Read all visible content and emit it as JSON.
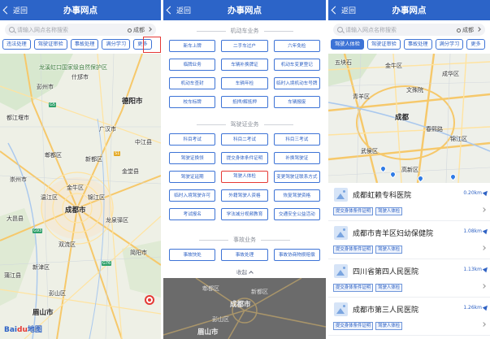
{
  "common": {
    "back_label": "返回",
    "title": "办事网点",
    "search_placeholder": "请输入网点名称搜索",
    "city": "成都",
    "logo_bai": "Bai",
    "logo_du": "du",
    "logo_cn": "地图"
  },
  "screen1": {
    "chips": [
      "违法处理",
      "驾驶证审验",
      "事故处理",
      "满分学习",
      "更多"
    ],
    "map_labels": {
      "city_main": "成都市",
      "city_deyang": "德阳市",
      "city_meishan": "眉山市",
      "area_1": "龙溪虹口国家级自然保护区",
      "area_2": "彭州市",
      "area_3": "什邡市",
      "area_4": "广汉市",
      "area_5": "中江县",
      "area_6": "都江堰市",
      "area_7": "郫都区",
      "area_8": "新都区",
      "area_9": "金堂县",
      "area_10": "崇州市",
      "area_11": "温江区",
      "area_12": "金牛区",
      "area_13": "锦江区",
      "area_14": "龙泉驿区",
      "area_15": "大邑县",
      "area_16": "双流区",
      "area_17": "简阳市",
      "area_18": "新津区",
      "area_19": "蒲江县",
      "area_20": "彭山区"
    }
  },
  "screen2": {
    "section_vehicle": "机动车业务",
    "vehicle_items": [
      "新车上牌",
      "二手车过户",
      "六年免检",
      "临牌业务",
      "车辆补换牌证",
      "机动车变更登记",
      "机动车查封",
      "车辆年检",
      "临时入境机动车号牌",
      "校车标牌",
      "抵押/解抵押",
      "车辆报废"
    ],
    "section_license": "驾驶证业务",
    "license_items": [
      "科目考试",
      "科目二考试",
      "科目三考试",
      "驾驶证换领",
      "提交身体条件证明",
      "补换驾驶证",
      "驾驶证延期",
      "驾驶人体检",
      "变更驾驶证联系方式",
      "临时入境驾驶许可",
      "外籍驾驶人资格",
      "恢复驾驶资格",
      "考试报名",
      "学法减分视频教育",
      "交通安全公益活动"
    ],
    "highlighted_item": "驾驶人体检",
    "section_accident": "事故业务",
    "accident_items": [
      "事故快处",
      "事故处理",
      "事故协商物损赔偿"
    ],
    "collapse_label": "收起",
    "dim_labels": {
      "city_main": "成都市",
      "city_meishan": "眉山市",
      "area_1": "郫都区",
      "area_2": "新都区",
      "area_3": "彭山区"
    }
  },
  "screen3": {
    "chips": [
      "驾驶人体检",
      "驾驶证审验",
      "事故处理",
      "满分学习",
      "更多"
    ],
    "selected_chip": "驾驶人体检",
    "map_labels": {
      "area_1": "成都",
      "area_2": "金牛区",
      "area_3": "成华区",
      "area_4": "青羊区",
      "area_5": "锦江区",
      "area_6": "武侯区",
      "area_7": "高新区",
      "area_8": "文殊院",
      "area_9": "春熙路",
      "area_10": "五块石"
    },
    "results": [
      {
        "name": "成都虹赖专科医院",
        "distance": "0.20km",
        "tags": [
          "提交身体条件证明",
          "驾驶人体检"
        ]
      },
      {
        "name": "成都市青羊区妇幼保健院",
        "distance": "1.08km",
        "tags": [
          "提交身体条件证明",
          "驾驶人体检"
        ]
      },
      {
        "name": "四川省第四人民医院",
        "distance": "1.13km",
        "tags": [
          "提交身体条件证明",
          "驾驶人体检"
        ]
      },
      {
        "name": "成都市第三人民医院",
        "distance": "1.26km",
        "tags": [
          "提交身体条件证明",
          "驾驶人体检"
        ]
      }
    ]
  },
  "colors": {
    "nav_blue": "#2c64c8",
    "chip_blue": "#3d73d6",
    "highlight_red": "#e53935"
  }
}
